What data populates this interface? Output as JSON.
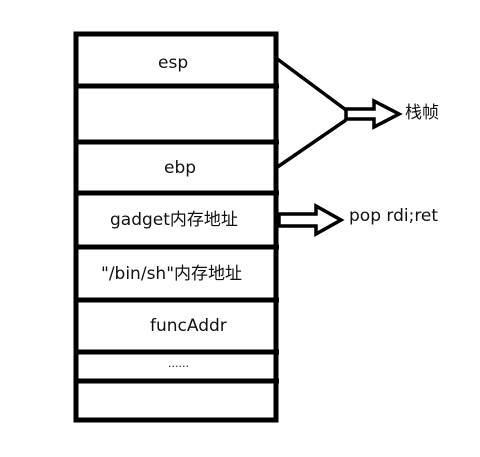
{
  "stack": {
    "cells": [
      {
        "label": "esp"
      },
      {
        "label": ""
      },
      {
        "label": "ebp"
      },
      {
        "label": "gadget内存地址"
      },
      {
        "label": "\"/bin/sh\"内存地址"
      },
      {
        "label": "funcAddr"
      },
      {
        "label": "......"
      },
      {
        "label": ""
      }
    ]
  },
  "annotations": {
    "frame_label": "栈帧",
    "gadget_label": "pop rdi;ret"
  },
  "colors": {
    "stroke": "#000000",
    "text": "#111111",
    "background": "#ffffff"
  }
}
